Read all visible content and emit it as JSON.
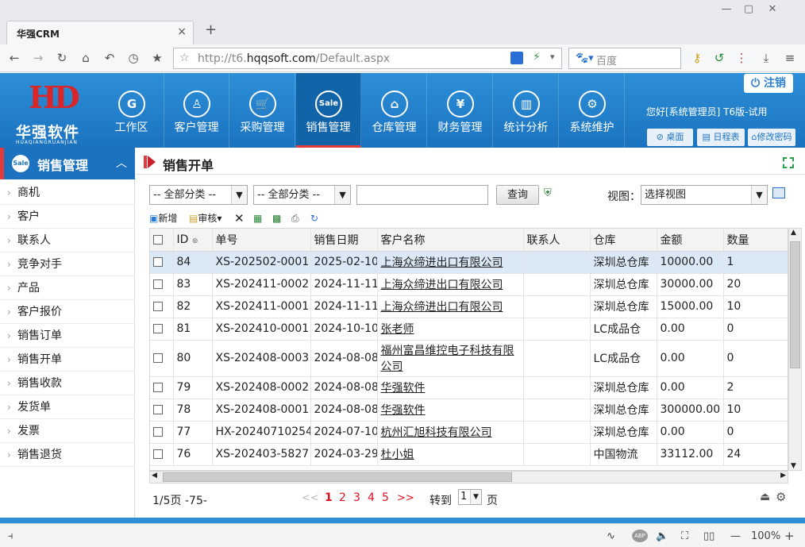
{
  "browser": {
    "tab_title": "华强CRM",
    "tab_close": "×",
    "new_tab": "+",
    "url_prefix": "http://t6.",
    "url_domain": "hqqsoft.com",
    "url_path": "/Default.aspx",
    "search_placeholder": "百度",
    "zoom": "100%"
  },
  "app": {
    "logo_cn": "华强软件",
    "logo_en": "HUAQIANGRUANJIAN",
    "logout": "注销",
    "greeting": "您好[系统管理员] T6版-试用",
    "header_buttons": [
      "桌面",
      "日程表",
      "修改密码"
    ],
    "nav": [
      {
        "label": "工作区",
        "icon": "G"
      },
      {
        "label": "客户管理",
        "icon": "♙"
      },
      {
        "label": "采购管理",
        "icon": "🛒"
      },
      {
        "label": "销售管理",
        "icon": "Sale"
      },
      {
        "label": "仓库管理",
        "icon": "⌂"
      },
      {
        "label": "财务管理",
        "icon": "¥"
      },
      {
        "label": "统计分析",
        "icon": "▥"
      },
      {
        "label": "系统维护",
        "icon": "⚙"
      }
    ],
    "active_nav": "销售管理"
  },
  "sidebar": {
    "title": "销售管理",
    "icon": "Sale",
    "items": [
      "商机",
      "客户",
      "联系人",
      "竞争对手",
      "产品",
      "客户报价",
      "销售订单",
      "销售开单",
      "销售收款",
      "发货单",
      "发票",
      "销售退货"
    ]
  },
  "main": {
    "title": "销售开单",
    "filter1": "-- 全部分类 --",
    "filter2": "-- 全部分类 --",
    "search_value": "",
    "query_button": "查询",
    "view_label": "视图：",
    "view_value": "选择视图",
    "toolbar": {
      "new": "新增",
      "audit": "审核"
    },
    "columns": [
      "ID",
      "单号",
      "销售日期",
      "客户名称",
      "联系人",
      "仓库",
      "金额",
      "数量"
    ],
    "rows": [
      {
        "id": "84",
        "no": "XS-202502-0001",
        "date": "2025-02-10",
        "customer": "上海众缔进出口有限公司",
        "contact": "",
        "warehouse": "深圳总仓库",
        "amount": "10000.00",
        "qty": "1"
      },
      {
        "id": "83",
        "no": "XS-202411-0002",
        "date": "2024-11-11",
        "customer": "上海众缔进出口有限公司",
        "contact": "",
        "warehouse": "深圳总仓库",
        "amount": "30000.00",
        "qty": "20"
      },
      {
        "id": "82",
        "no": "XS-202411-0001",
        "date": "2024-11-11",
        "customer": "上海众缔进出口有限公司",
        "contact": "",
        "warehouse": "深圳总仓库",
        "amount": "15000.00",
        "qty": "10"
      },
      {
        "id": "81",
        "no": "XS-202410-0001",
        "date": "2024-10-10",
        "customer": "张老师",
        "contact": "",
        "warehouse": "LC成品仓",
        "amount": "0.00",
        "qty": "0"
      },
      {
        "id": "80",
        "no": "XS-202408-0003",
        "date": "2024-08-08",
        "customer": "福州富昌维控电子科技有限公司",
        "contact": "",
        "warehouse": "LC成品仓",
        "amount": "0.00",
        "qty": "0"
      },
      {
        "id": "79",
        "no": "XS-202408-0002",
        "date": "2024-08-08",
        "customer": "华强软件",
        "contact": "",
        "warehouse": "深圳总仓库",
        "amount": "0.00",
        "qty": "2"
      },
      {
        "id": "78",
        "no": "XS-202408-0001",
        "date": "2024-08-08",
        "customer": "华强软件",
        "contact": "",
        "warehouse": "深圳总仓库",
        "amount": "300000.00",
        "qty": "10"
      },
      {
        "id": "77",
        "no": "HX-20240710254",
        "date": "2024-07-10",
        "customer": "杭州汇旭科技有限公司",
        "contact": "",
        "warehouse": "深圳总仓库",
        "amount": "0.00",
        "qty": "0"
      },
      {
        "id": "76",
        "no": "XS-202403-5827",
        "date": "2024-03-29",
        "customer": "杜小姐",
        "contact": "",
        "warehouse": "中国物流",
        "amount": "33112.00",
        "qty": "24"
      }
    ],
    "pager": {
      "info": "1/5页 -75-",
      "prev": "<<",
      "pages": [
        "1",
        "2",
        "3",
        "4",
        "5"
      ],
      "next": ">>",
      "goto_label": "转到",
      "goto_value": "1",
      "page_suffix": "页"
    }
  }
}
